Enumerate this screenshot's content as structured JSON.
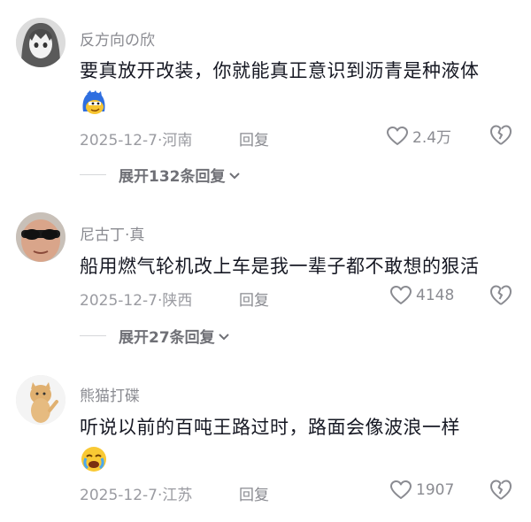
{
  "comments": [
    {
      "username": "反方向の欣",
      "content": "要真放开改装，你就能真正意识到沥青是种液体",
      "emoji": "mocking-face-emoji",
      "date": "2025-12-7",
      "location": "河南",
      "reply_label": "回复",
      "likes": "2.4万",
      "expand_label": "展开132条回复"
    },
    {
      "username": "尼古丁·真",
      "content": "船用燃气轮机改上车是我一辈子都不敢想的狠活",
      "date": "2025-12-7",
      "location": "陕西",
      "reply_label": "回复",
      "likes": "4148",
      "expand_label": "展开27条回复"
    },
    {
      "username": "熊猫打碟",
      "content": "听说以前的百吨王路过时，路面会像波浪一样",
      "emoji": "crying-face-emoji",
      "date": "2025-12-7",
      "location": "江苏",
      "reply_label": "回复",
      "likes": "1907"
    }
  ],
  "colors": {
    "text": "#161823",
    "muted": "#8a8b91",
    "meta": "#9a9ba1"
  },
  "separator": "·"
}
